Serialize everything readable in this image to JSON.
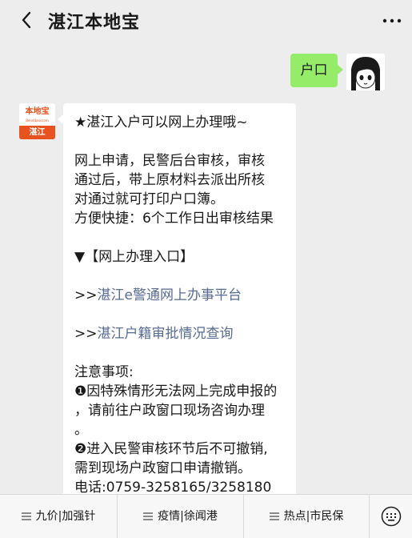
{
  "header": {
    "title": "湛江本地宝",
    "back_icon": "chevron-left-icon",
    "more_icon": "more-dots-icon"
  },
  "user_message": {
    "text": "户口",
    "bubble_color": "#95ec69"
  },
  "bot": {
    "avatar": {
      "logo_text": "本地宝",
      "logo_url": "Bendibao.com",
      "city": "湛江",
      "brand_color": "#e8521f"
    },
    "message": {
      "line1": "★湛江入户可以网上办理哦~",
      "para1_line1": "网上申请，民警后台审核，审核",
      "para1_line2": "通过后，带上原材料去派出所核",
      "para1_line3": "对通过就可打印户口簿。",
      "para2": "方便快捷：6个工作日出审核结果",
      "section_title": "▼【网上办理入口】",
      "link1_prefix": ">>",
      "link1": "湛江e警通网上办事平台",
      "link2_prefix": ">>",
      "link2": "湛江户籍审批情况查询",
      "notes_title": "注意事项:",
      "note1_line1": "❶因特殊情形无法网上完成申报的",
      "note1_line2": "，请前往户政窗口现场咨询办理",
      "note1_line3": "。",
      "note2_line1": "❷进入民警审核环节后不可撤销,",
      "note2_line2": "需到现场户政窗口申请撤销。",
      "phone": "电话:0759-3258165/3258180"
    },
    "link_color": "#576b95"
  },
  "bottom_menu": {
    "items": [
      {
        "label": "九价|加强针"
      },
      {
        "label": "疫情|徐闻港"
      },
      {
        "label": "热点|市民保"
      }
    ],
    "keyboard_icon": "keyboard-icon"
  }
}
